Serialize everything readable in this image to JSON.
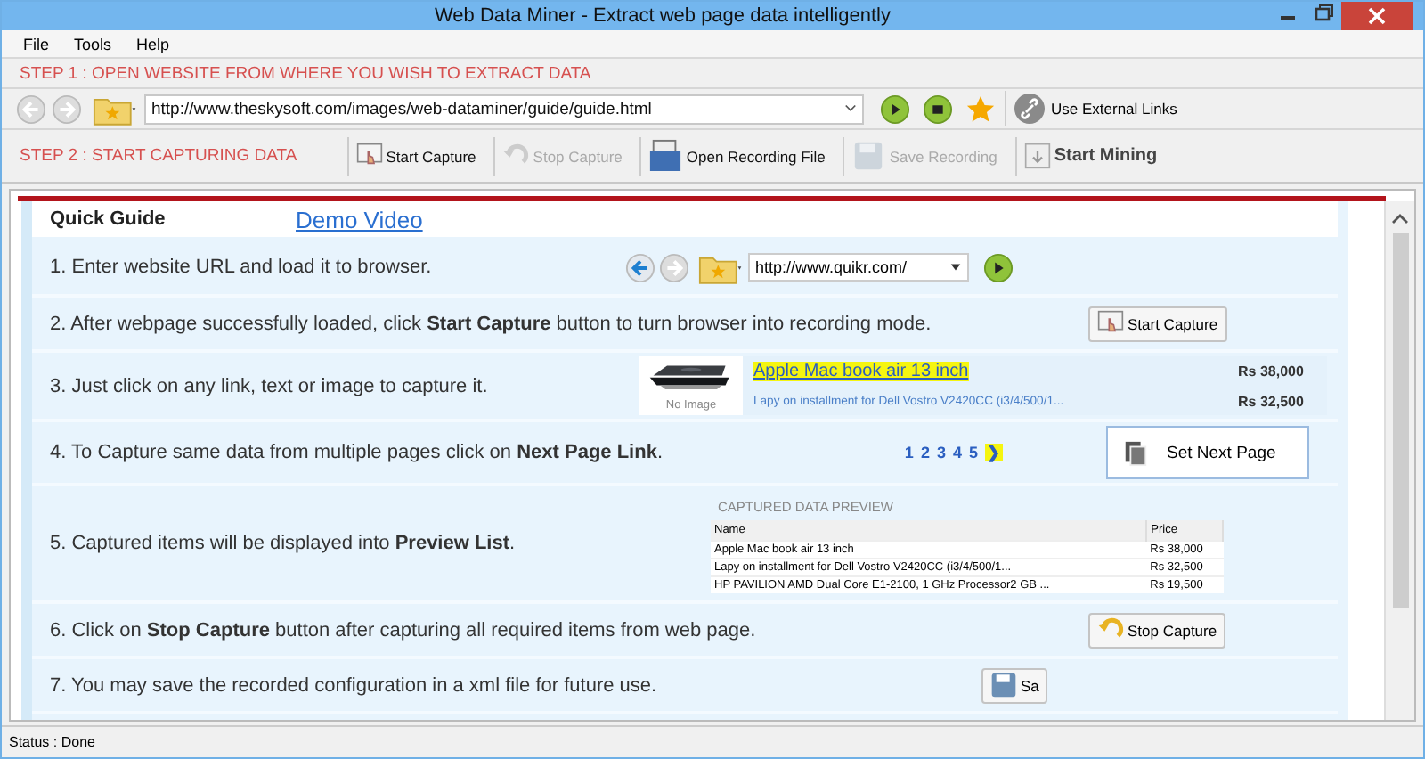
{
  "window": {
    "title": "Web Data Miner -  Extract web page data intelligently"
  },
  "menu": [
    "File",
    "Tools",
    "Help"
  ],
  "step1": {
    "label": "STEP 1 : OPEN WEBSITE FROM WHERE YOU WISH TO EXTRACT DATA",
    "url": "http://www.theskysoft.com/images/web-dataminer/guide/guide.html",
    "external_links": "Use External Links"
  },
  "step2": {
    "label": "STEP 2 : START CAPTURING DATA",
    "buttons": [
      {
        "kind": "capture",
        "label": "Start Capture",
        "disabled": false
      },
      {
        "kind": "stop",
        "label": "Stop Capture",
        "disabled": true
      },
      {
        "kind": "open",
        "label": "Open Recording File",
        "disabled": false
      },
      {
        "kind": "save",
        "label": "Save Recording",
        "disabled": true
      },
      {
        "kind": "mine",
        "label": "Start Mining",
        "disabled": false
      }
    ]
  },
  "guide": {
    "tabs": [
      {
        "label": "Quick Guide",
        "selected": true
      },
      {
        "label": "Demo Video",
        "selected": false
      }
    ],
    "steps": [
      {
        "kind": "browser",
        "text": "1. Enter website URL and load it to browser.",
        "url": "http://www.quikr.com/"
      },
      {
        "kind": "capture",
        "text": "2. After webpage successfully loaded, click **Start Capture** button to turn browser into recording mode.",
        "button": "Start Capture"
      },
      {
        "kind": "products",
        "text": "3. Just click on any link, text or image to capture it.",
        "caption": "No Image",
        "items": [
          {
            "title": "Apple Mac book air 13 inch",
            "price": "Rs 38,000",
            "highlighted": true
          },
          {
            "title": "Lapy on installment for Dell Vostro V2420CC (i3/4/500/1...",
            "price": "Rs 32,500",
            "highlighted": false
          }
        ]
      },
      {
        "kind": "pager",
        "text": "4. To Capture same data from multiple pages click on **Next Page Link**.",
        "pages": [
          "1",
          "2",
          "3",
          "4",
          "5"
        ],
        "next": "❯",
        "next_highlighted": true,
        "button": "Set Next Page"
      },
      {
        "kind": "preview",
        "text": "5. Captured items will be displayed into **Preview List**.",
        "title": "CAPTURED DATA PREVIEW",
        "columns": [
          "Name",
          "Price"
        ],
        "rows": [
          [
            "Apple Mac book air 13 inch",
            "Rs 38,000"
          ],
          [
            "Lapy on installment for Dell Vostro V2420CC (i3/4/500/1...",
            "Rs 32,500"
          ],
          [
            "HP PAVILION AMD Dual Core E1-2100, 1 GHz Processor2 GB ...",
            "Rs 19,500"
          ]
        ]
      },
      {
        "kind": "stop",
        "text": "6. Click on **Stop Capture** button after capturing all required items from web page.",
        "button": "Stop Capture"
      },
      {
        "kind": "save",
        "text": "7. You may save the recorded configuration in a xml file for future use.",
        "button": "Sa"
      }
    ]
  },
  "status": "Status :  Done"
}
